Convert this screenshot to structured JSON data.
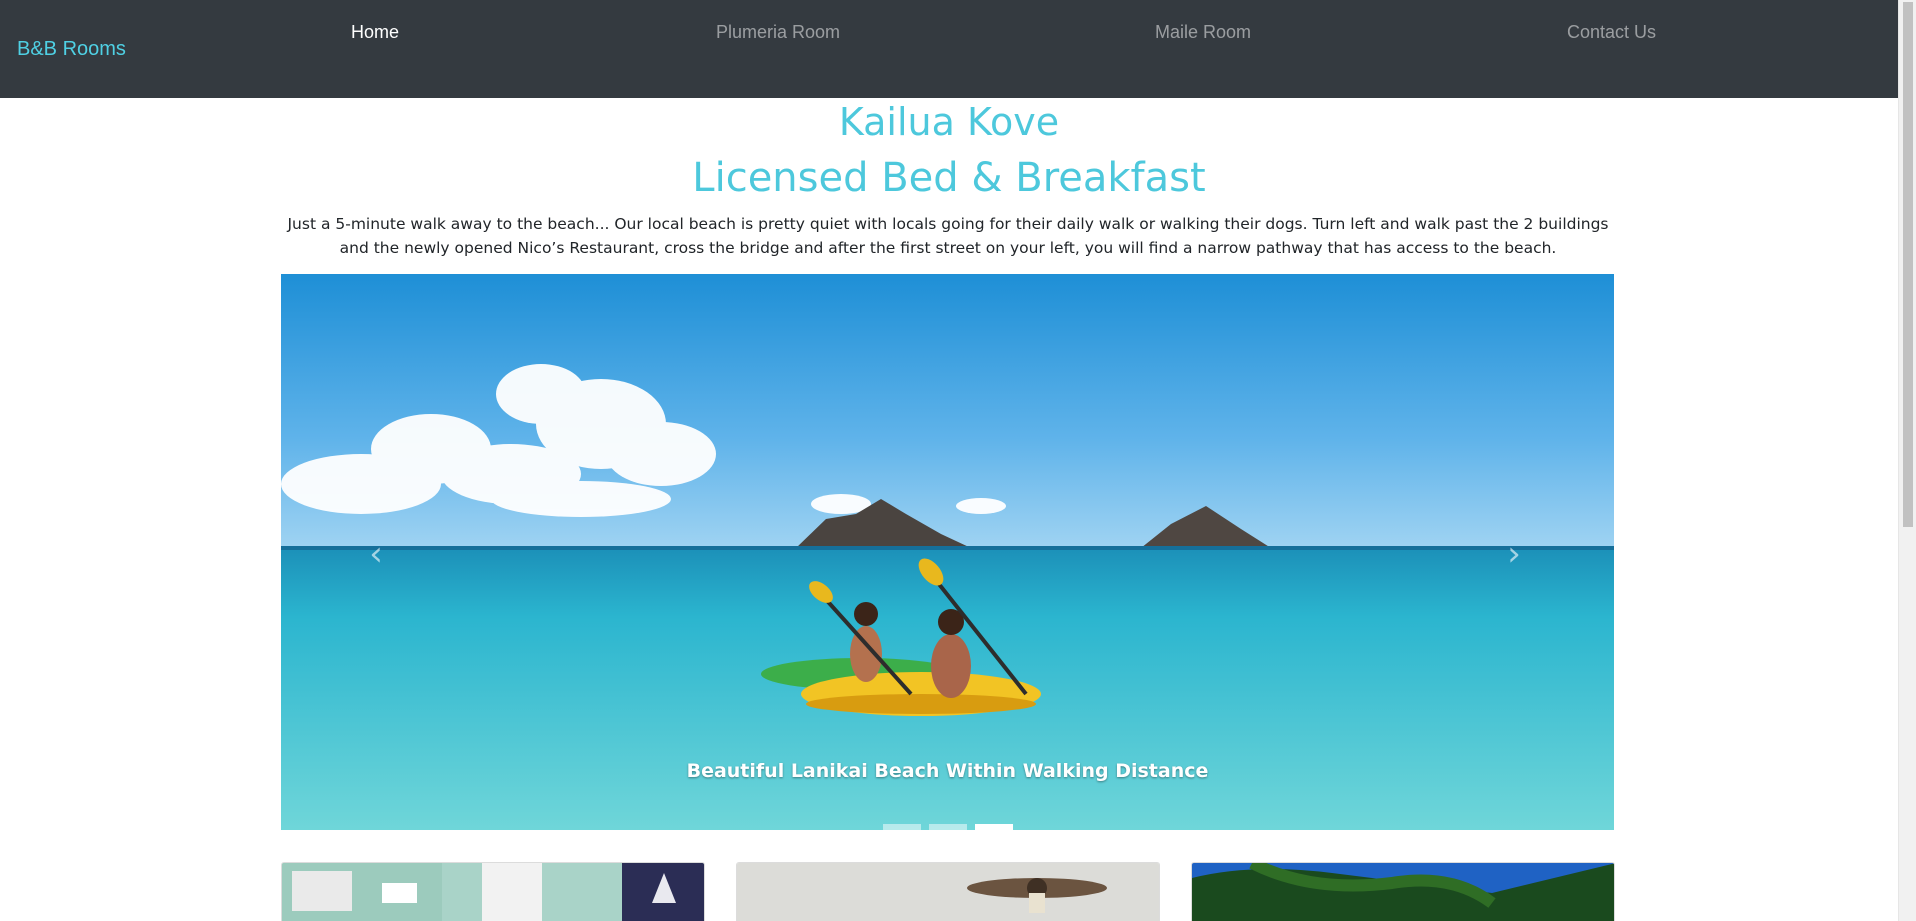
{
  "navbar": {
    "brand": "B&B Rooms",
    "links": [
      {
        "label": "Home",
        "active": true
      },
      {
        "label": "Plumeria Room",
        "active": false
      },
      {
        "label": "Maile Room",
        "active": false
      },
      {
        "label": "Contact Us",
        "active": false
      }
    ]
  },
  "header": {
    "title": "Kailua Kove",
    "subtitle": "Licensed Bed & Breakfast",
    "intro": "Just a 5-minute walk away to the beach... Our local beach is pretty quiet with locals going for their daily walk or walking their dogs. Turn left and walk past the 2 buildings and the newly opened Nico’s Restaurant, cross the bridge and after the first street on your left, you will find a narrow pathway that has access to the beach."
  },
  "carousel": {
    "caption": "Beautiful Lanikai Beach Within Walking Distance",
    "prev_icon": "chevron-left-icon",
    "next_icon": "chevron-right-icon",
    "slide_count": 3,
    "active_slide": 3
  },
  "colors": {
    "navbar_bg": "#343a40",
    "brand": "#4fd0e4",
    "title": "#4dc8dc"
  }
}
